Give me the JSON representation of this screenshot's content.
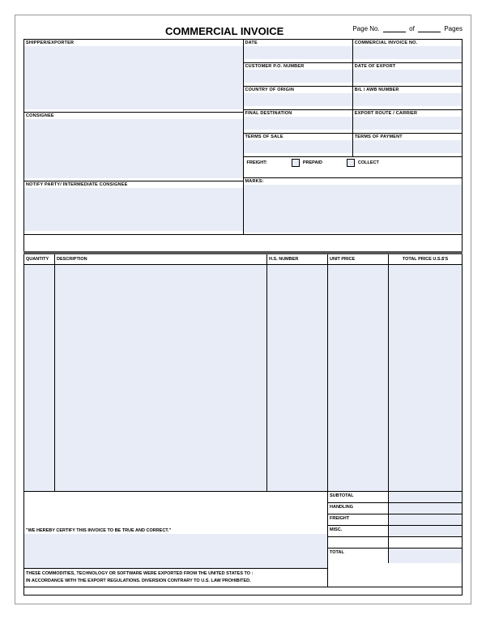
{
  "header": {
    "title": "COMMERCIAL INVOICE",
    "page_label": "Page No.",
    "of_label": "of",
    "pages_label": "Pages"
  },
  "left": {
    "shipper": "SHIPPER/EXPORTER",
    "consignee": "CONSIGNEE",
    "notify": "NOTIFY PARTY/ INTERMEDIATE CONSIGNEE"
  },
  "right": {
    "date": "DATE",
    "invoice_no": "COMMERCIAL INVOICE NO.",
    "customer_po": "CUSTOMER P.O. NUMBER",
    "date_export": "DATE OF EXPORT",
    "country_origin": "COUNTRY OF ORIGIN",
    "bl_awb": "B/L / AWB NUMBER",
    "final_dest": "FINAL DESTINATION",
    "export_route": "EXPORT ROUTE / CARRIER",
    "terms_sale": "TERMS OF SALE",
    "terms_payment": "TERMS OF PAYMENT",
    "freight": "FREIGHT:",
    "prepaid": "PREPAID",
    "collect": "COLLECT",
    "marks": "MARKS:"
  },
  "columns": {
    "quantity": "QUANTITY",
    "description": "DESCRIPTION",
    "hs": "H.S. NUMBER",
    "unit": "UNIT PRICE",
    "total": "TOTAL PRICE U.S.$'S"
  },
  "cert": "\"WE HEREBY CERTIFY THIS INVOICE TO BE TRUE AND CORRECT.\"",
  "disclaimer_line1": "THESE COMMODITIES, TECHNOLOGY OR SOFTWARE WERE EXPORTED FROM THE UNITED STATES TO :",
  "disclaimer_line2": "IN ACCORDANCE WITH THE EXPORT REGULATIONS.  DIVERSION CONTRARY TO U.S. LAW PROHIBITED.",
  "summary": {
    "subtotal": "SUBTOTAL",
    "handling": "HANDLING",
    "freight": "FREIGHT",
    "misc": "MISC.",
    "total": "TOTAL"
  }
}
